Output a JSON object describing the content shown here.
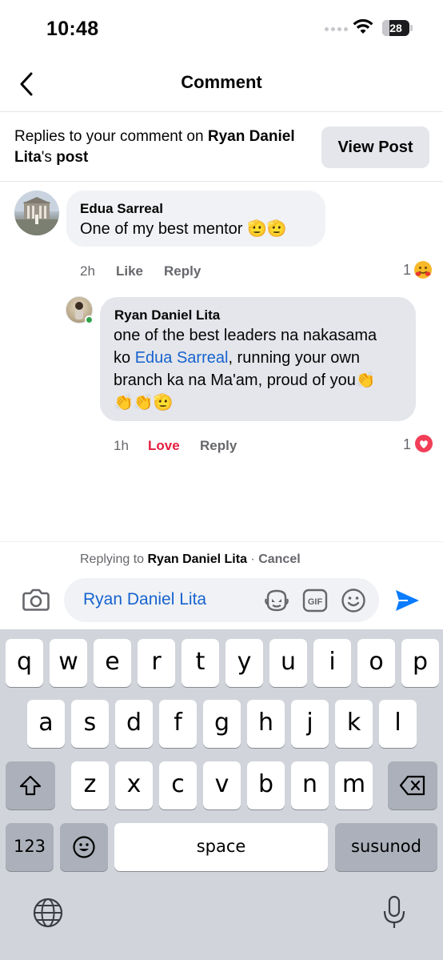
{
  "status_bar": {
    "time": "10:48",
    "battery": "28"
  },
  "nav": {
    "title": "Comment"
  },
  "banner": {
    "prefix": "Replies to your comment on ",
    "name": "Ryan Daniel Lita",
    "suffix": "'s ",
    "post_word": "post",
    "view_post_label": "View Post"
  },
  "comment": {
    "author": "Edua Sarreal",
    "text": "One of my best mentor",
    "emojis": "🫡🫡",
    "time": "2h",
    "like_label": "Like",
    "reply_label": "Reply",
    "reaction_count": "1",
    "reaction_icon": "hugging-face-emoji"
  },
  "reply": {
    "author": "Ryan Daniel Lita",
    "line1": "one of the best leaders na nakasama",
    "line2_before": "ko ",
    "mention": "Edua Sarreal",
    "line2_after": ", running your own",
    "line3": "branch ka na Ma'am, proud of you",
    "line4_emojis": "👏👏🫡",
    "line3_emoji": "👏",
    "time": "1h",
    "love_label": "Love",
    "reply_label": "Reply",
    "reaction_count": "1",
    "reaction_icon": "heart-emoji"
  },
  "composer": {
    "replying_prefix": "Replying to ",
    "replying_name": "Ryan Daniel Lita",
    "separator": " · ",
    "cancel_label": "Cancel",
    "input_value": "Ryan Daniel Lita",
    "accent": "#1763cf"
  },
  "keyboard": {
    "row1": [
      "q",
      "w",
      "e",
      "r",
      "t",
      "y",
      "u",
      "i",
      "o",
      "p"
    ],
    "row2": [
      "a",
      "s",
      "d",
      "f",
      "g",
      "h",
      "j",
      "k",
      "l"
    ],
    "row3": [
      "z",
      "x",
      "c",
      "v",
      "b",
      "n",
      "m"
    ],
    "numbers_label": "123",
    "space_label": "space",
    "return_label": "susunod"
  }
}
